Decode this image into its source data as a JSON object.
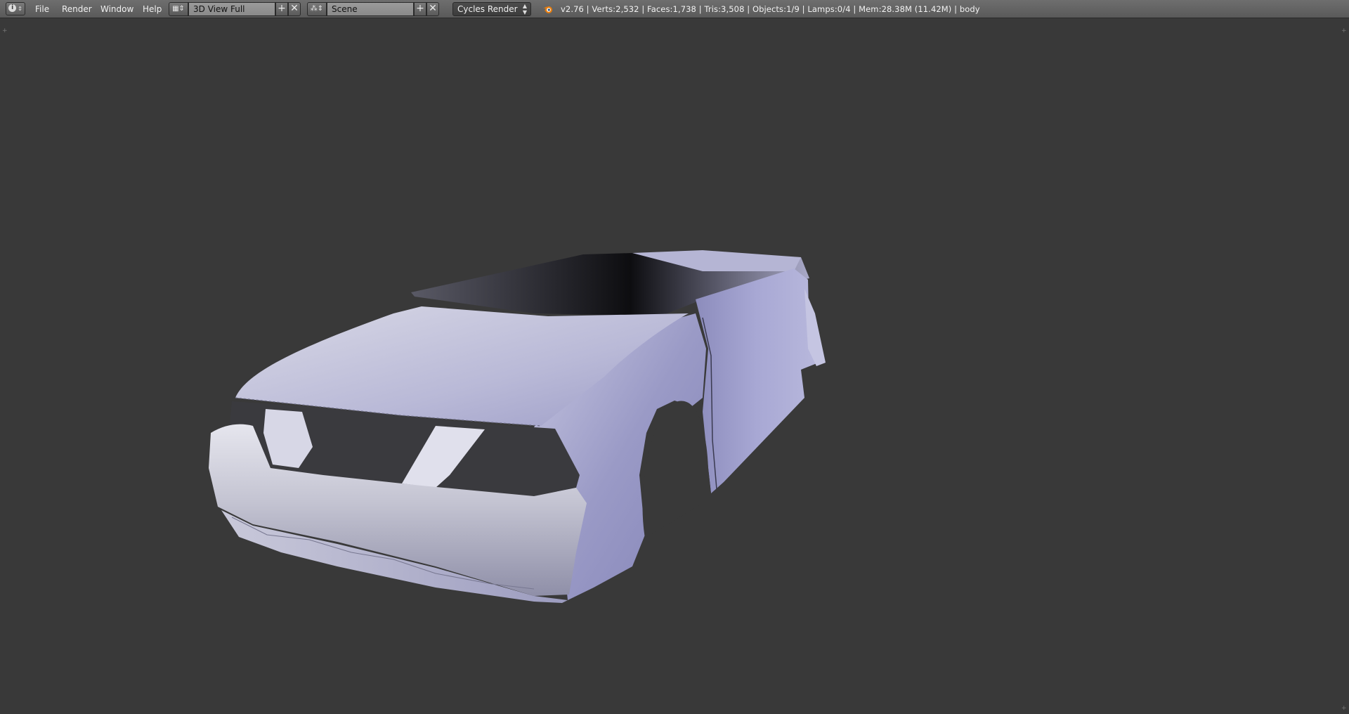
{
  "header": {
    "editor_type_icon": "info-icon",
    "menus": [
      "File",
      "Render",
      "Window",
      "Help"
    ],
    "screen_layout": "3D View Full",
    "scene": "Scene",
    "render_engine": "Cycles Render",
    "stats": "v2.76 | Verts:2,532 | Faces:1,738 | Tris:3,508 | Objects:1/9 | Lamps:0/4 | Mem:28.38M (11.42M) | body"
  },
  "icons": {
    "layout": "screen-layout-icon",
    "scene": "scene-icon",
    "add": "plus-icon",
    "remove": "close-icon",
    "logo": "blender-logo-icon"
  },
  "colors": {
    "viewport_bg": "#393939",
    "header_bg": "#6e6e6e",
    "mesh_light": "#d8d8e8",
    "mesh_mid": "#a9a9cf",
    "mesh_dark": "#6e6e90"
  }
}
